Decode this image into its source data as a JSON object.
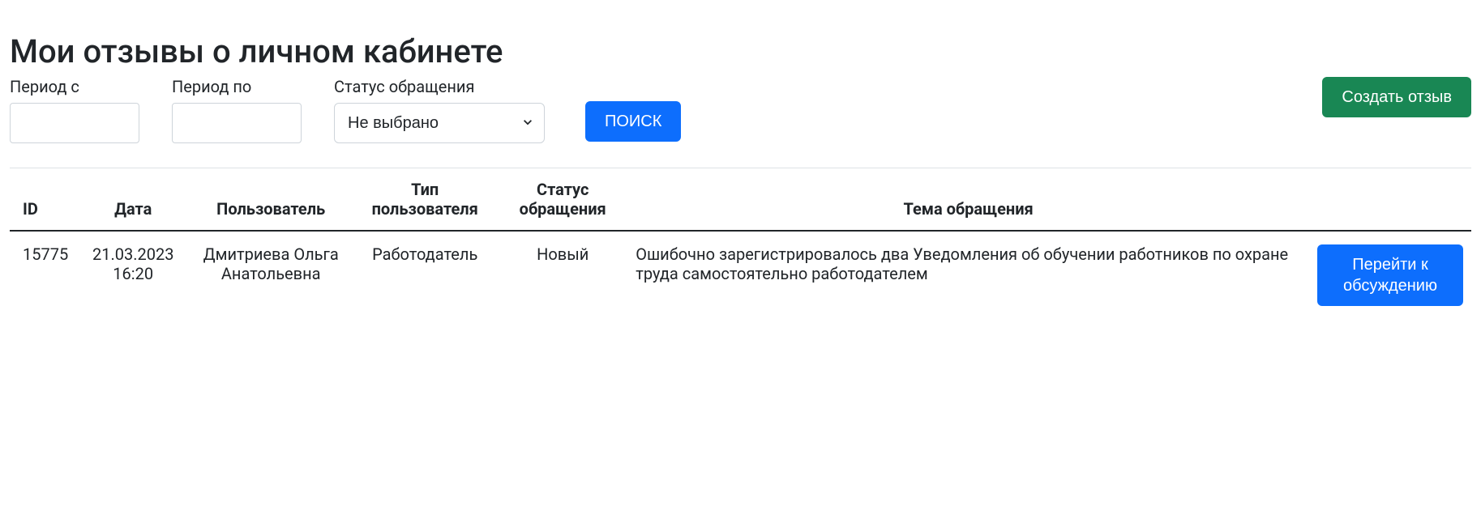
{
  "page": {
    "title": "Мои отзывы о личном кабинете"
  },
  "filters": {
    "period_from_label": "Период с",
    "period_to_label": "Период по",
    "status_label": "Статус обращения",
    "status_selected": "Не выбрано",
    "search_label": "ПОИСК",
    "create_label": "Создать отзыв"
  },
  "table": {
    "headers": {
      "id": "ID",
      "date": "Дата",
      "user": "Пользователь",
      "user_type": "Тип пользователя",
      "status": "Статус обращения",
      "topic": "Тема обращения",
      "action": ""
    },
    "rows": [
      {
        "id": "15775",
        "date": "21.03.2023 16:20",
        "user": "Дмитриева Ольга Анатольевна",
        "user_type": "Работодатель",
        "status": "Новый",
        "topic": "Ошибочно зарегистрировалось два Уведомления об обучении работников по охране труда самостоятельно работодателем",
        "action_label": "Перейти к обсуждению"
      }
    ]
  }
}
